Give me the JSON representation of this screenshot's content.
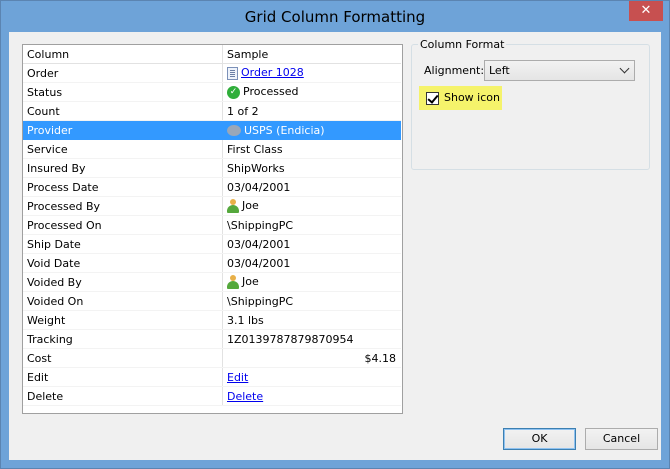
{
  "window": {
    "title": "Grid Column Formatting",
    "close_glyph": "✕"
  },
  "grid": {
    "headers": [
      "Column",
      "Sample"
    ],
    "rows": [
      {
        "column": "Order",
        "sample": "Order 1028",
        "icon": "order-icon",
        "link": true
      },
      {
        "column": "Status",
        "sample": "Processed",
        "icon": "check-icon"
      },
      {
        "column": "Count",
        "sample": "1 of 2"
      },
      {
        "column": "Provider",
        "sample": "USPS (Endicia)",
        "icon": "usps-icon",
        "selected": true
      },
      {
        "column": "Service",
        "sample": "First Class"
      },
      {
        "column": "Insured By",
        "sample": "ShipWorks"
      },
      {
        "column": "Process Date",
        "sample": "03/04/2001"
      },
      {
        "column": "Processed By",
        "sample": "Joe",
        "icon": "user-icon"
      },
      {
        "column": "Processed On",
        "sample": "\\ShippingPC"
      },
      {
        "column": "Ship Date",
        "sample": "03/04/2001"
      },
      {
        "column": "Void Date",
        "sample": "03/04/2001"
      },
      {
        "column": "Voided By",
        "sample": "Joe",
        "icon": "user-icon"
      },
      {
        "column": "Voided On",
        "sample": "\\ShippingPC"
      },
      {
        "column": "Weight",
        "sample": "3.1 lbs"
      },
      {
        "column": "Tracking",
        "sample": "1Z0139787879870954"
      },
      {
        "column": "Cost",
        "sample": "$4.18",
        "align": "right"
      },
      {
        "column": "Edit",
        "sample": "Edit",
        "link": true
      },
      {
        "column": "Delete",
        "sample": "Delete",
        "link": true
      }
    ]
  },
  "format": {
    "group_label": "Column Format",
    "alignment_label": "Alignment:",
    "alignment_value": "Left",
    "show_icon_label": "Show icon",
    "show_icon_checked": true,
    "highlight_color": "#f5f36b"
  },
  "buttons": {
    "ok": "OK",
    "cancel": "Cancel"
  },
  "colors": {
    "selection": "#3399ff",
    "link": "#0000ee",
    "title_bar": "#6ea3d8",
    "close": "#c75050"
  }
}
